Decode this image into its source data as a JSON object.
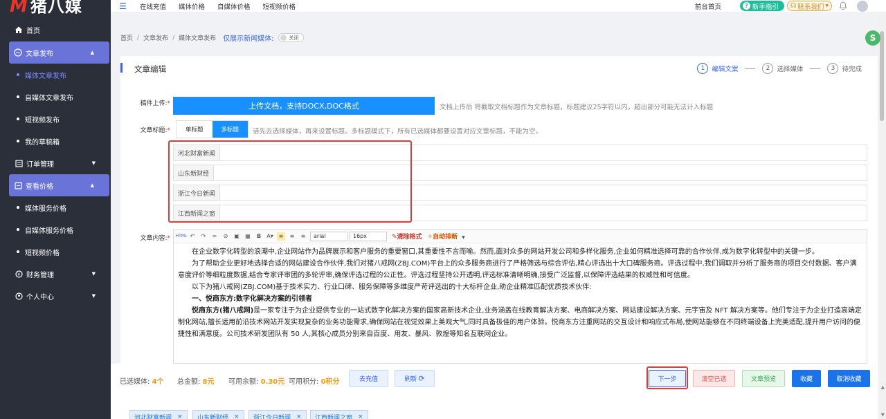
{
  "brand": {
    "logo_letter": "M",
    "logo_text": "猪八媒"
  },
  "sidebar": {
    "items": [
      {
        "label": "首页"
      },
      {
        "label": "文章发布"
      },
      {
        "label": "媒体文章发布"
      },
      {
        "label": "自媒体文章发布"
      },
      {
        "label": "短视频发布"
      },
      {
        "label": "我的草稿箱"
      },
      {
        "label": "订单管理"
      },
      {
        "label": "查看价格"
      },
      {
        "label": "媒体服务价格"
      },
      {
        "label": "自媒体服务价格"
      },
      {
        "label": "短视频价格"
      },
      {
        "label": "财务管理"
      },
      {
        "label": "个人中心"
      }
    ]
  },
  "topbar": {
    "links": [
      "在线充值",
      "媒体价格",
      "自媒体价格",
      "短视频价格"
    ],
    "front": "前台首页",
    "guide": "新手指引",
    "contact": "联系我们"
  },
  "breadcrumb": {
    "items": [
      "首页",
      "文章发布",
      "媒体文章发布"
    ],
    "only_news": "仅展示新闻媒体:",
    "toggle_label": "关闭"
  },
  "card": {
    "title": "文章编辑",
    "steps": [
      {
        "num": "1",
        "label": "编辑文案"
      },
      {
        "num": "2",
        "label": "选择媒体"
      },
      {
        "num": "3",
        "label": "待完成"
      }
    ],
    "upload_label": "稿件上传:",
    "upload_button": "上传文档，支持DOCX,DOC格式",
    "upload_hint": "文档上传后 将截取文档标题作为文章标题，标题建议25字符以内，超出部分可能无法计入标题",
    "title_label": "文章标题:",
    "title_modes": [
      "单标题",
      "多标题"
    ],
    "title_hint": "请先去选择媒体，再来设置标题。多标题模式下，所有已选媒体都要设置对应文章标题，不能为空。",
    "title_rows": [
      "河北财富新闻",
      "山东新财经",
      "浙江今日新闻",
      "江西新闻之窗"
    ],
    "content_label": "文章内容:",
    "toolbar": {
      "font": "arial",
      "size": "16px",
      "clear": "清除格式",
      "auto": "自动排新"
    },
    "paragraphs": [
      "在企业数字化转型的浪潮中,企业网站作为品牌展示和客户服务的重要窗口,其重要性不言而喻。然而,面对众多的网站开发公司和多样化服务,企业如何精准选择可靠的合作伙伴,成为数字化转型中的关键一步。",
      "为了帮助企业更好地选择合适的网站建设合作伙伴,我们对猪八戒网(ZBJ.COM)平台上的众多服务商进行了严格筛选与综合评估,精心评选出十大口碑服务商。评选过程中,我们调取并分析了服务商的项目交付数据、客户满意度评价等细粒度数据,结合专家评审团的多轮评审,确保评选过程的公正性。评选过程坚持公开透明,评选标准清晰明确,接受广泛监督,以保障评选结果的权威性和可信度。",
      "以下为猪八戒网(ZBJ.COM)基于技术实力、行业口碑、服务保障等多维度严苛评选出的十大标杆企业,助企业精准匹配优质技术伙伴:"
    ],
    "heading1": "一、悦商东方:数字化解决方案的引领者",
    "para_bold": "悦商东方(猪八戒网)",
    "para_rest": "是一家专注于为企业提供专业的一站式数字化解决方案的国家高新技术企业,业务涵盖在线教育解决方案、电商解决方案、网站建设解决方案、元宇宙及 NFT 解决方案等。他们专注于为企业打造高端定制化网站,擅长运用前沿技术网站开发实现复杂的业务功能需求,确保网站在视觉效果上美观大气,同时具备极佳的用户体验。悦商东方注重网站的交互设计和响应式布局,使网站能够在不同终端设备上完美适配,提升用户访问的便捷性和满意度。公司技术研发团队有 50 人,其核心成员分别来自百度、用友、暴风、敦煌等知名互联网企业。"
  },
  "bottom": {
    "selected_label": "已选媒体:",
    "selected_val": "4个",
    "total_label": "总金额:",
    "total_val": "8元",
    "balance_label": "可用余额:",
    "balance_val": "0.30元",
    "points_label": "可用积分:",
    "points_val": "0积分",
    "recharge": "去充值",
    "refresh": "刷新",
    "next": "下一步",
    "clear": "清空已选",
    "preview": "文章预览",
    "fav": "收藏",
    "unfav": "取消收藏"
  },
  "chips": [
    "河北财富新闻",
    "山东新财经",
    "浙江今日新闻",
    "江西新闻之窗"
  ],
  "float_badge": "S",
  "colors": {
    "sidebar": "#2b2f3a",
    "accent": "#6a74d8",
    "primary": "#1890ff"
  }
}
